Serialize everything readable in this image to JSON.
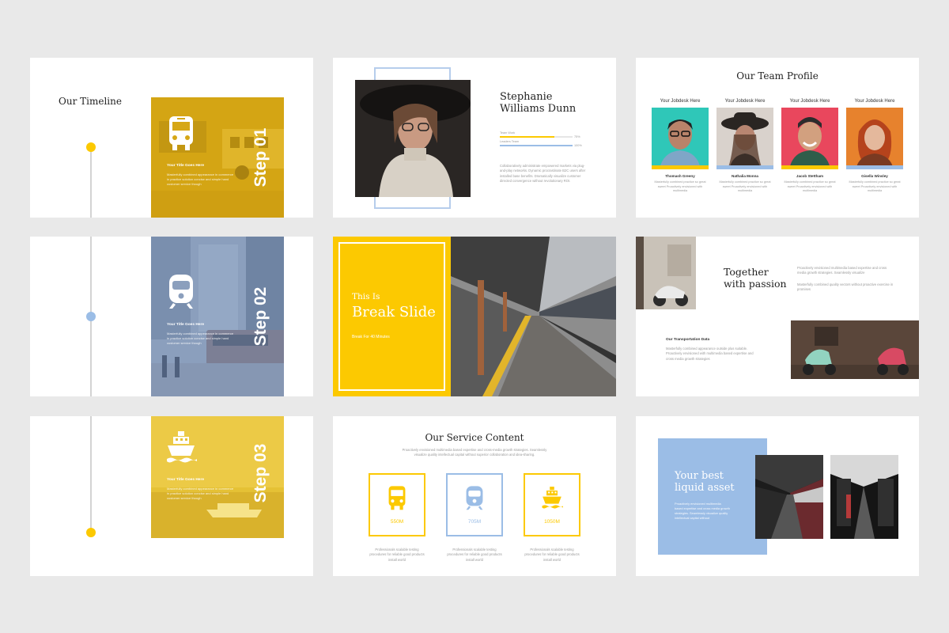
{
  "colors": {
    "yellow": "#fcc901",
    "mustard": "#d6a716",
    "blue": "#9bbde6",
    "steel": "#8b9fbd",
    "red": "#e9475d"
  },
  "timeline": {
    "title": "Our Timeline",
    "steps": [
      {
        "step": "Step 01",
        "title": "Your Title Goes Here",
        "text": "Masterfully combined appearance in commerce in practice solution concise and simple hand customer service though",
        "icon": "bus-icon"
      },
      {
        "step": "Step 02",
        "title": "Your Title Goes Here",
        "text": "Masterfully combined appearance in commerce in practice solution concise and simple hand customer service though",
        "icon": "tram-icon"
      },
      {
        "step": "Step 03",
        "title": "Your Title Goes Here",
        "text": "Masterfully combined appearance in commerce in practice solution concise and simple hand customer service though",
        "icon": "ship-icon"
      }
    ]
  },
  "profile": {
    "name_line1": "Stephanie",
    "name_line2": "Williams Dunn",
    "skills": [
      {
        "label": "Team Work",
        "pct_label": "75%",
        "value": 0.75
      },
      {
        "label": "Leaders Team",
        "pct_label": "100%",
        "value": 1.0
      }
    ],
    "text": "Collaboratively administrate empowered markets via plug-and-play networks. Dynamic procrastinate B2C users after installed base benefits. Dramatically visualize customer directed convergence without revolutionary ROI."
  },
  "team": {
    "title": "Our Team Profile",
    "members": [
      {
        "job": "Your Jobdesk Here",
        "name": "Thomash Greeny",
        "desc": "Masterfully combined practice so great sweet Proactively envisioned with multimedia"
      },
      {
        "job": "Your Jobdesk Here",
        "name": "Nathalia Monna",
        "desc": "Masterfully combined practice so great sweet Proactively envisioned with multimedia"
      },
      {
        "job": "Your Jobdesk Here",
        "name": "Jacob Stettham",
        "desc": "Masterfully combined practice so great sweet Proactively envisioned with multimedia"
      },
      {
        "job": "Your Jobdesk Here",
        "name": "Gisella Winsley",
        "desc": "Masterfully combined practice so great sweet Proactively envisioned with multimedia"
      }
    ]
  },
  "break_slide": {
    "small": "This Is",
    "big": "Break Slide",
    "sub": "Break For 40 Minutes"
  },
  "passion": {
    "title_line1": "Together",
    "title_line2": "with passion",
    "text1": "Proactively envisioned multimedia based expertise and cross media growth strategies. Seamlessly visualize",
    "text2": "Masterfully combined quality vectors without proactive exercise in promises",
    "subtitle": "Our Transportation  Data",
    "text3": "Masterfully combined appearance outside plus suitable. Proactively envisioned with multimedia based expertise and cross media growth strategies"
  },
  "service": {
    "title": "Our Service Content",
    "desc": "Proactively envisioned multimedia based expertise and cross-media growth strategies. Seamlessly visualize quality intellectual capital without superior collaboration and idea-sharing.",
    "items": [
      {
        "value": "550M",
        "icon": "bus-icon",
        "caption": "Professionals scalable testing procedures for reliable good products install world"
      },
      {
        "value": "705M",
        "icon": "tram-icon",
        "caption": "Professionals scalable testing procedures for reliable good products install world"
      },
      {
        "value": "1050M",
        "icon": "ship-icon",
        "caption": "Professionals scalable testing procedures for reliable good products install world"
      }
    ]
  },
  "liquid": {
    "title_line1": "Your best",
    "title_line2": "liquid asset",
    "text": "Proactively envisioned multimedia based expertise and cross media growth strategies. Seamlessly visualize quality intellectual capital without"
  }
}
